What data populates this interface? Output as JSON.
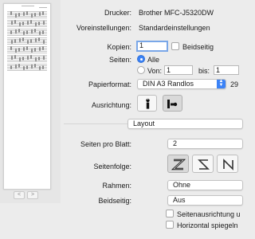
{
  "printer": {
    "label": "Drucker:",
    "value": "Brother MFC-J5320DW"
  },
  "presets": {
    "label": "Voreinstellungen:",
    "value": "Standardeinstellungen"
  },
  "copies": {
    "label": "Kopien:",
    "value": "1",
    "duplex_label": "Beidseitig"
  },
  "pages": {
    "label": "Seiten:",
    "all_label": "Alle",
    "from_label": "Von:",
    "from_value": "1",
    "to_label": "bis:",
    "to_value": "1"
  },
  "paper": {
    "label": "Papierformat:",
    "value": "DIN A3 Randlos",
    "size_text": "29"
  },
  "orientation": {
    "label": "Ausrichtung:"
  },
  "section": {
    "value": "Layout"
  },
  "layout": {
    "pages_per_sheet": {
      "label": "Seiten pro Blatt:",
      "value": "2"
    },
    "page_order": {
      "label": "Seitenfolge:"
    },
    "border": {
      "label": "Rahmen:",
      "value": "Ohne"
    },
    "two_sided": {
      "label": "Beidseitig:",
      "value": "Aus"
    },
    "reverse_orientation": {
      "label": "Seitenausrichtung u"
    },
    "flip_horizontal": {
      "label": "Horizontal spiegeln"
    }
  },
  "pager": {
    "prev": "<",
    "next": ">"
  },
  "colors": {
    "accent": "#3b82f6",
    "background": "#ececec"
  }
}
